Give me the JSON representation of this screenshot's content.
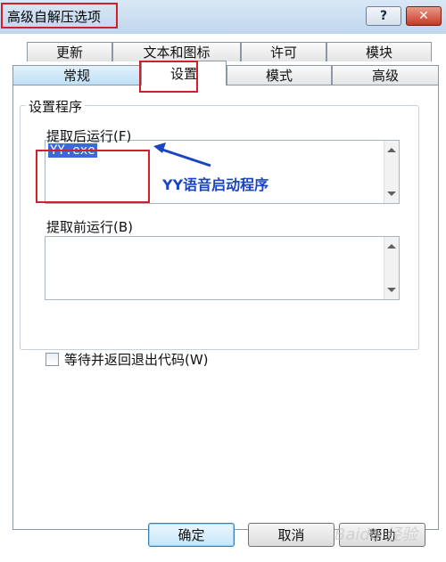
{
  "window": {
    "title": "高级自解压选项",
    "help_label": "?",
    "close_label": "✕"
  },
  "tabs": {
    "row1": [
      "更新",
      "文本和图标",
      "许可",
      "模块"
    ],
    "row2": [
      "常规",
      "设置",
      "模式",
      "高级"
    ],
    "active": "设置"
  },
  "setup": {
    "group_title": "设置程序",
    "after_label": "提取后运行(F)",
    "after_value": "YY.exe",
    "before_label": "提取前运行(B)",
    "before_value": "",
    "wait_label": "等待并返回退出代码(W)",
    "wait_checked": false
  },
  "annotation": {
    "text": "YY语音启动程序",
    "color": "#1a44c2"
  },
  "buttons": {
    "ok": "确定",
    "cancel": "取消",
    "help": "帮助"
  },
  "watermark": "Baidu 经验"
}
